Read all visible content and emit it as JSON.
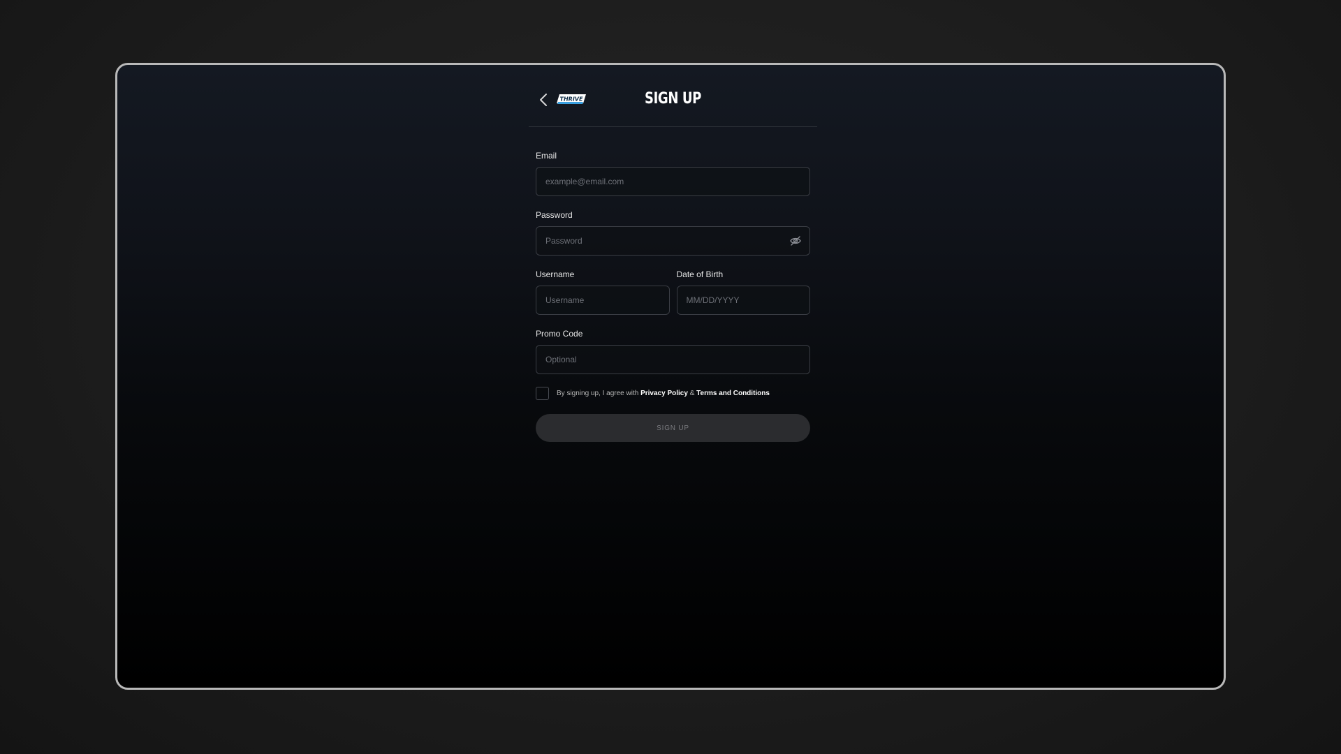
{
  "header": {
    "title": "SIGN UP",
    "logo_text": "THRIVE",
    "back_icon": "chevron-left-icon"
  },
  "form": {
    "email": {
      "label": "Email",
      "placeholder": "example@email.com"
    },
    "password": {
      "label": "Password",
      "placeholder": "Password",
      "toggle_icon": "eye-off-icon"
    },
    "username": {
      "label": "Username",
      "placeholder": "Username"
    },
    "dob": {
      "label": "Date of Birth",
      "placeholder": "MM/DD/YYYY"
    },
    "promo": {
      "label": "Promo Code",
      "placeholder": "Optional"
    },
    "agreement": {
      "prefix": "By signing up, I agree with",
      "privacy_link": "Privacy Policy",
      "separator": "&",
      "terms_link": "Terms and Conditions",
      "checked": false
    },
    "submit_label": "SIGN UP"
  },
  "colors": {
    "background": "#1e1e1e",
    "device_border": "#b9b9b9",
    "logo_blue": "#3aa0e0",
    "button_bg": "#2b2c2f"
  }
}
